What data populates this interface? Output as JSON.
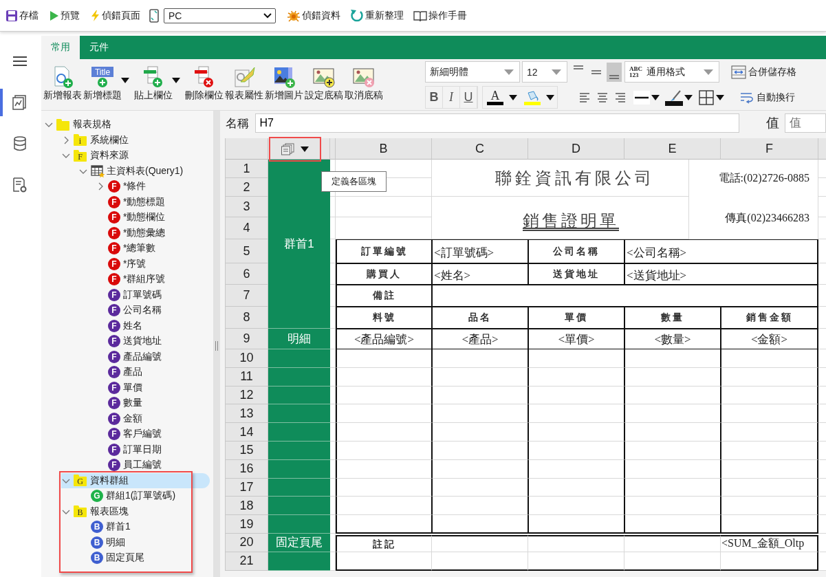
{
  "toolbar": [
    {
      "kind": "save",
      "label": "存檔"
    },
    {
      "kind": "preview",
      "label": "預覽"
    },
    {
      "kind": "debug-page",
      "label": "偵錯頁面"
    },
    {
      "kind": "device"
    },
    {
      "kind": "select",
      "value": "PC"
    },
    {
      "kind": "debug-data",
      "label": "偵錯資料"
    },
    {
      "kind": "refresh",
      "label": "重新整理"
    },
    {
      "kind": "manual",
      "label": "操作手冊"
    }
  ],
  "rail": [
    {
      "kind": "menu",
      "selected": false
    },
    {
      "kind": "report",
      "selected": true
    },
    {
      "kind": "database",
      "selected": false
    },
    {
      "kind": "document",
      "selected": false
    }
  ],
  "tabs": [
    {
      "label": "常用",
      "selected": true
    },
    {
      "label": "元件",
      "selected": false
    }
  ],
  "ribbon": {
    "buttons": [
      {
        "kind": "new-report",
        "label": "新增報表",
        "dropdown": false
      },
      {
        "kind": "new-title",
        "label": "新增標題",
        "icon_text": "Title",
        "dropdown": true
      },
      {
        "kind": "paste-field",
        "label": "貼上欄位",
        "dropdown": true
      },
      {
        "kind": "delete-field",
        "label": "刪除欄位",
        "dropdown": false
      },
      {
        "kind": "report-properties",
        "label": "報表屬性",
        "dropdown": false
      },
      {
        "kind": "new-image",
        "label": "新增圖片",
        "dropdown": false
      },
      {
        "kind": "set-background",
        "label": "設定底稿",
        "dropdown": false
      },
      {
        "kind": "clear-background",
        "label": "取消底稿",
        "dropdown": false
      }
    ],
    "font": "新細明體",
    "size": "12",
    "vertical_align": [
      {
        "kind": "top",
        "selected": false
      },
      {
        "kind": "middle",
        "selected": false
      },
      {
        "kind": "bottom",
        "selected": true
      }
    ],
    "number_format": {
      "badge": [
        "ABC",
        "123"
      ],
      "value": "通用格式"
    },
    "merge": "合併儲存格",
    "styles": [
      {
        "kind": "bold",
        "label": "B",
        "selected": false
      },
      {
        "kind": "italic",
        "label": "I",
        "selected": false
      },
      {
        "kind": "underline",
        "label": "U",
        "selected": false
      }
    ],
    "colors": [
      {
        "kind": "font",
        "label": "A",
        "color": "#000000"
      },
      {
        "kind": "fill",
        "color": "#ffff00"
      }
    ],
    "align": [
      {
        "kind": "left",
        "selected": false
      },
      {
        "kind": "center",
        "selected": false
      },
      {
        "kind": "right",
        "selected": false
      }
    ],
    "border_tools": [
      {
        "kind": "line-style"
      },
      {
        "kind": "border-color"
      },
      {
        "kind": "borders"
      }
    ],
    "wrap": "自動換行"
  },
  "tree": {
    "label": "報表規格",
    "icon": {
      "kind": "folder"
    },
    "expanded": true,
    "selected": false,
    "children": [
      {
        "label": "系統欄位",
        "icon": {
          "kind": "folder",
          "letter": "i"
        },
        "expanded": false,
        "selected": false,
        "highlighted": false
      },
      {
        "label": "資料來源",
        "icon": {
          "kind": "folder",
          "letter": "F"
        },
        "expanded": true,
        "selected": false,
        "highlighted": false,
        "children": [
          {
            "label": "主資料表(Query1)",
            "icon": {
              "kind": "table"
            },
            "expanded": true,
            "selected": false,
            "children": [
              {
                "label": "*條件",
                "icon": {
                  "kind": "badge",
                  "letter": "F",
                  "color": "#d90a0a"
                },
                "expanded": false,
                "selected": false
              },
              {
                "label": "*動態標題",
                "icon": {
                  "kind": "badge",
                  "letter": "F",
                  "color": "#d90a0a"
                },
                "selected": false
              },
              {
                "label": "*動態欄位",
                "icon": {
                  "kind": "badge",
                  "letter": "F",
                  "color": "#d90a0a"
                },
                "selected": false
              },
              {
                "label": "*動態彙總",
                "icon": {
                  "kind": "badge",
                  "letter": "F",
                  "color": "#d90a0a"
                },
                "selected": false
              },
              {
                "label": "*總筆數",
                "icon": {
                  "kind": "badge",
                  "letter": "F",
                  "color": "#d90a0a"
                },
                "selected": false
              },
              {
                "label": "*序號",
                "icon": {
                  "kind": "badge",
                  "letter": "F",
                  "color": "#d90a0a"
                },
                "selected": false
              },
              {
                "label": "*群組序號",
                "icon": {
                  "kind": "badge",
                  "letter": "F",
                  "color": "#d90a0a"
                },
                "selected": false
              },
              {
                "label": "訂單號碼",
                "icon": {
                  "kind": "badge",
                  "letter": "F",
                  "color": "#5b2a9c"
                },
                "selected": false
              },
              {
                "label": "公司名稱",
                "icon": {
                  "kind": "badge",
                  "letter": "F",
                  "color": "#5b2a9c"
                },
                "selected": false
              },
              {
                "label": "姓名",
                "icon": {
                  "kind": "badge",
                  "letter": "F",
                  "color": "#5b2a9c"
                },
                "selected": false
              },
              {
                "label": "送貨地址",
                "icon": {
                  "kind": "badge",
                  "letter": "F",
                  "color": "#5b2a9c"
                },
                "selected": false
              },
              {
                "label": "產品編號",
                "icon": {
                  "kind": "badge",
                  "letter": "F",
                  "color": "#5b2a9c"
                },
                "selected": false
              },
              {
                "label": "產品",
                "icon": {
                  "kind": "badge",
                  "letter": "F",
                  "color": "#5b2a9c"
                },
                "selected": false
              },
              {
                "label": "單價",
                "icon": {
                  "kind": "badge",
                  "letter": "F",
                  "color": "#5b2a9c"
                },
                "selected": false
              },
              {
                "label": "數量",
                "icon": {
                  "kind": "badge",
                  "letter": "F",
                  "color": "#5b2a9c"
                },
                "selected": false
              },
              {
                "label": "金額",
                "icon": {
                  "kind": "badge",
                  "letter": "F",
                  "color": "#5b2a9c"
                },
                "selected": false
              },
              {
                "label": "客戶編號",
                "icon": {
                  "kind": "badge",
                  "letter": "F",
                  "color": "#5b2a9c"
                },
                "selected": false
              },
              {
                "label": "訂單日期",
                "icon": {
                  "kind": "badge",
                  "letter": "F",
                  "color": "#5b2a9c"
                },
                "selected": false
              },
              {
                "label": "員工編號",
                "icon": {
                  "kind": "badge",
                  "letter": "F",
                  "color": "#5b2a9c"
                },
                "selected": false
              }
            ]
          }
        ]
      },
      {
        "label": "資料群組",
        "icon": {
          "kind": "folder",
          "letter": "G"
        },
        "expanded": true,
        "selected": true,
        "highlighted": true,
        "children": [
          {
            "label": "群組1(訂單號碼)",
            "icon": {
              "kind": "badge",
              "letter": "G",
              "color": "#1fb24a"
            },
            "selected": false
          }
        ]
      },
      {
        "label": "報表區塊",
        "icon": {
          "kind": "folder",
          "letter": "B"
        },
        "expanded": true,
        "selected": false,
        "highlighted": true,
        "children": [
          {
            "label": "群首1",
            "icon": {
              "kind": "badge",
              "letter": "B",
              "color": "#3f5fd0"
            },
            "selected": false
          },
          {
            "label": "明細",
            "icon": {
              "kind": "badge",
              "letter": "B",
              "color": "#3f5fd0"
            },
            "selected": false
          },
          {
            "label": "固定頁尾",
            "icon": {
              "kind": "badge",
              "letter": "B",
              "color": "#3f5fd0"
            },
            "selected": false
          }
        ]
      }
    ]
  },
  "sheet": {
    "name_label": "名稱",
    "name_value": "H7",
    "value_label": "值",
    "value_placeholder": "值",
    "block_button": {
      "highlighted": true,
      "tooltip": "定義各區塊"
    },
    "columns": [
      "B",
      "C",
      "D",
      "E",
      "F"
    ],
    "rows": [
      {
        "number": "1",
        "block": {
          "kind": "labelled",
          "label": "群首1"
        },
        "cells": [
          {
            "kind": "blank"
          },
          {
            "kind": "title",
            "text": "聯銓資訊有限公司"
          },
          {
            "kind": "merge"
          },
          {
            "kind": "merge"
          },
          {
            "kind": "contact",
            "text": "電話:(02)2726-0885"
          }
        ]
      },
      {
        "number": "2",
        "block": {
          "kind": "merged"
        },
        "cells": [
          {
            "kind": "blank"
          },
          {
            "kind": "covered"
          },
          {
            "kind": "covered"
          },
          {
            "kind": "covered"
          },
          {
            "kind": "covered"
          }
        ]
      },
      {
        "number": "3",
        "block": {
          "kind": "merged"
        },
        "cells": [
          {
            "kind": "blank"
          },
          {
            "kind": "subtitle",
            "text": "銷售證明單"
          },
          {
            "kind": "merge"
          },
          {
            "kind": "merge"
          },
          {
            "kind": "contact",
            "text": "傳真(02)23466283"
          }
        ]
      },
      {
        "number": "4",
        "block": {
          "kind": "merged"
        },
        "cells": [
          {
            "kind": "blank"
          },
          {
            "kind": "covered"
          },
          {
            "kind": "covered"
          },
          {
            "kind": "covered"
          },
          {
            "kind": "covered"
          }
        ]
      },
      {
        "number": "5",
        "block": {
          "kind": "merged"
        },
        "cells": [
          {
            "kind": "label",
            "text": "訂單編號"
          },
          {
            "kind": "field",
            "text": "<訂單號碼>"
          },
          {
            "kind": "label",
            "text": "公司名稱"
          },
          {
            "kind": "field",
            "text": "<公司名稱>"
          },
          {
            "kind": "merge"
          }
        ]
      },
      {
        "number": "6",
        "block": {
          "kind": "merged"
        },
        "cells": [
          {
            "kind": "label",
            "text": "購買人"
          },
          {
            "kind": "field",
            "text": "<姓名>"
          },
          {
            "kind": "label",
            "text": "送貨地址"
          },
          {
            "kind": "field",
            "text": "<送貨地址>"
          },
          {
            "kind": "merge"
          }
        ]
      },
      {
        "number": "7",
        "block": {
          "kind": "merged"
        },
        "cells": [
          {
            "kind": "label",
            "text": "備註"
          },
          {
            "kind": "boxed"
          },
          {
            "kind": "merge"
          },
          {
            "kind": "merge"
          },
          {
            "kind": "merge"
          }
        ]
      },
      {
        "number": "8",
        "block": {
          "kind": "merged"
        },
        "cells": [
          {
            "kind": "label",
            "text": "料號"
          },
          {
            "kind": "label",
            "text": "品名"
          },
          {
            "kind": "label",
            "text": "單價"
          },
          {
            "kind": "label",
            "text": "數量"
          },
          {
            "kind": "label",
            "text": "銷售金額"
          }
        ]
      },
      {
        "number": "9",
        "block": {
          "kind": "labelled",
          "label": "明細"
        },
        "cells": [
          {
            "kind": "field-center",
            "text": "<產品編號>"
          },
          {
            "kind": "field-center",
            "text": "<產品>"
          },
          {
            "kind": "field-center",
            "text": "<單價>"
          },
          {
            "kind": "field-center",
            "text": "<數量>"
          },
          {
            "kind": "field-center",
            "text": "<金額>"
          }
        ]
      },
      {
        "number": "10",
        "block": {
          "kind": "plain"
        },
        "cells": [
          {
            "kind": "column"
          },
          {
            "kind": "column"
          },
          {
            "kind": "column"
          },
          {
            "kind": "column"
          },
          {
            "kind": "column"
          }
        ]
      },
      {
        "number": "11",
        "block": {
          "kind": "plain"
        },
        "cells": [
          {
            "kind": "column"
          },
          {
            "kind": "column"
          },
          {
            "kind": "column"
          },
          {
            "kind": "column"
          },
          {
            "kind": "column"
          }
        ]
      },
      {
        "number": "12",
        "block": {
          "kind": "plain"
        },
        "cells": [
          {
            "kind": "column"
          },
          {
            "kind": "column"
          },
          {
            "kind": "column"
          },
          {
            "kind": "column"
          },
          {
            "kind": "column"
          }
        ]
      },
      {
        "number": "13",
        "block": {
          "kind": "plain"
        },
        "cells": [
          {
            "kind": "column"
          },
          {
            "kind": "column"
          },
          {
            "kind": "column"
          },
          {
            "kind": "column"
          },
          {
            "kind": "column"
          }
        ]
      },
      {
        "number": "14",
        "block": {
          "kind": "plain"
        },
        "cells": [
          {
            "kind": "column"
          },
          {
            "kind": "column"
          },
          {
            "kind": "column"
          },
          {
            "kind": "column"
          },
          {
            "kind": "column"
          }
        ]
      },
      {
        "number": "15",
        "block": {
          "kind": "plain"
        },
        "cells": [
          {
            "kind": "column"
          },
          {
            "kind": "column"
          },
          {
            "kind": "column"
          },
          {
            "kind": "column"
          },
          {
            "kind": "column"
          }
        ]
      },
      {
        "number": "16",
        "block": {
          "kind": "plain"
        },
        "cells": [
          {
            "kind": "column"
          },
          {
            "kind": "column"
          },
          {
            "kind": "column"
          },
          {
            "kind": "column"
          },
          {
            "kind": "column"
          }
        ]
      },
      {
        "number": "17",
        "block": {
          "kind": "plain"
        },
        "cells": [
          {
            "kind": "column"
          },
          {
            "kind": "column"
          },
          {
            "kind": "column"
          },
          {
            "kind": "column"
          },
          {
            "kind": "column"
          }
        ]
      },
      {
        "number": "18",
        "block": {
          "kind": "plain"
        },
        "cells": [
          {
            "kind": "column"
          },
          {
            "kind": "column"
          },
          {
            "kind": "column"
          },
          {
            "kind": "column"
          },
          {
            "kind": "column"
          }
        ]
      },
      {
        "number": "19",
        "block": {
          "kind": "plain"
        },
        "cells": [
          {
            "kind": "column-end"
          },
          {
            "kind": "column-end"
          },
          {
            "kind": "column-end"
          },
          {
            "kind": "column-end"
          },
          {
            "kind": "column-end"
          }
        ]
      },
      {
        "number": "20",
        "block": {
          "kind": "labelled",
          "label": "固定頁尾"
        },
        "cells": [
          {
            "kind": "footer-label",
            "text": "註記"
          },
          {
            "kind": "footer-top"
          },
          {
            "kind": "footer-top"
          },
          {
            "kind": "footer-top"
          },
          {
            "kind": "footer-field",
            "text": "<SUM_金額_Oltp"
          }
        ]
      },
      {
        "number": "21",
        "block": {
          "kind": "plain"
        },
        "cells": [
          {
            "kind": "footer-bottom"
          },
          {
            "kind": "footer-bottom"
          },
          {
            "kind": "footer-bottom"
          },
          {
            "kind": "footer-bottom"
          },
          {
            "kind": "footer-bottom"
          }
        ]
      }
    ]
  }
}
